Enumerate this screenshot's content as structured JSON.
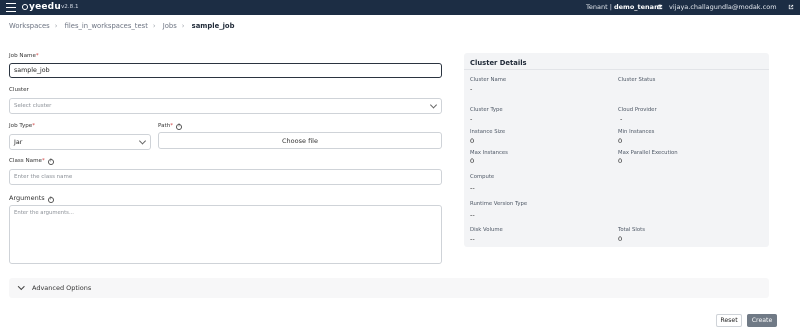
{
  "topbar": {
    "logo": "yeedu",
    "version": "v2.8.1",
    "tenant_label": "Tenant |",
    "tenant_name": "demo_tenant",
    "user_email": "vijaya.challagundla@modak.com"
  },
  "breadcrumb": {
    "items": [
      "Workspaces",
      "files_in_workspaces_test",
      "Jobs"
    ],
    "current": "sample_job"
  },
  "form": {
    "job_name_label": "Job Name",
    "job_name_value": "sample_job",
    "cluster_label": "Cluster",
    "cluster_placeholder": "Select cluster",
    "job_type_label": "Job Type",
    "job_type_value": "Jar",
    "path_label": "Path",
    "choose_file_label": "Choose file",
    "class_name_label": "Class Name",
    "class_name_placeholder": "Enter the class name",
    "arguments_label": "Arguments",
    "arguments_placeholder": "Enter the arguments..."
  },
  "cluster_details": {
    "title": "Cluster Details",
    "fields": {
      "cluster_name": {
        "label": "Cluster Name",
        "value": "-"
      },
      "cluster_status": {
        "label": "Cluster Status",
        "value": ""
      },
      "cluster_type": {
        "label": "Cluster Type",
        "value": "-"
      },
      "cloud_provider": {
        "label": "Cloud Provider",
        "value": "-"
      },
      "instance_size": {
        "label": "Instance Size",
        "value": "0"
      },
      "min_instances": {
        "label": "Min Instances",
        "value": "0"
      },
      "max_instances": {
        "label": "Max Instances",
        "value": "0"
      },
      "max_parallel": {
        "label": "Max Parallel Execution",
        "value": "0"
      },
      "compute": {
        "label": "Compute",
        "value": "--"
      },
      "runtime_version": {
        "label": "Runtime Version Type",
        "value": "--"
      },
      "disk_volume": {
        "label": "Disk Volume",
        "value": "--"
      },
      "total_slots": {
        "label": "Total Slots",
        "value": "0"
      }
    }
  },
  "advanced": {
    "label": "Advanced Options"
  },
  "actions": {
    "reset_label": "Reset",
    "create_label": "Create"
  },
  "colors": {
    "topbar": "#1c2d44",
    "create_button": "#707a86",
    "required": "#d14343"
  }
}
